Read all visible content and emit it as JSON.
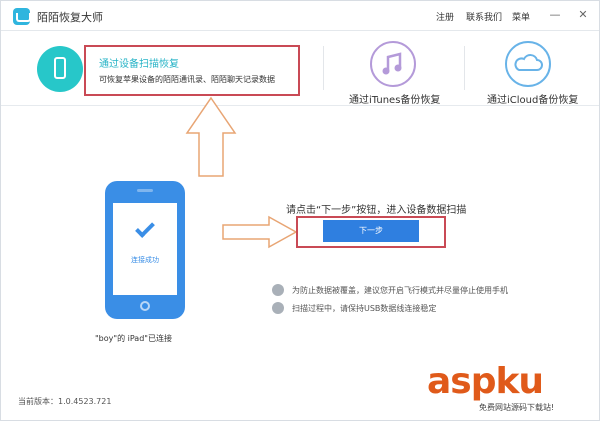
{
  "window": {
    "app_title": "陌陌恢复大师",
    "menu": [
      "注册",
      "联系我们",
      "菜单"
    ],
    "controls": {
      "minimize": "—",
      "close": "✕"
    }
  },
  "modes": {
    "device_scan": {
      "title": "通过设备扫描恢复",
      "description": "可恢复苹果设备的陌陌通讯录、陌陌聊天记录数据"
    },
    "itunes": {
      "label": "通过iTunes备份恢复"
    },
    "icloud": {
      "label": "通过iCloud备份恢复"
    }
  },
  "device": {
    "status": "连接成功",
    "name": "\"boy\"的 iPad\"已连接"
  },
  "main": {
    "instruction": "请点击“下一步”按钮，进入设备数据扫描",
    "next_button": "下一步"
  },
  "tips": [
    {
      "icon": "airplane-icon",
      "text": "为防止数据被覆盖，建议您开启飞行模式并尽量停止使用手机"
    },
    {
      "icon": "usb-icon",
      "text": "扫描过程中，请保持USB数据线连接稳定"
    }
  ],
  "footer": {
    "version": "当前版本：1.0.4523.721"
  },
  "watermark": {
    "main": "aspku",
    "sub": "免费网站源码下载站!"
  },
  "colors": {
    "accent": "#2f7fe0",
    "teal": "#27c7c9",
    "highlight_border": "#c94a55",
    "arrow": "#e8a574"
  }
}
